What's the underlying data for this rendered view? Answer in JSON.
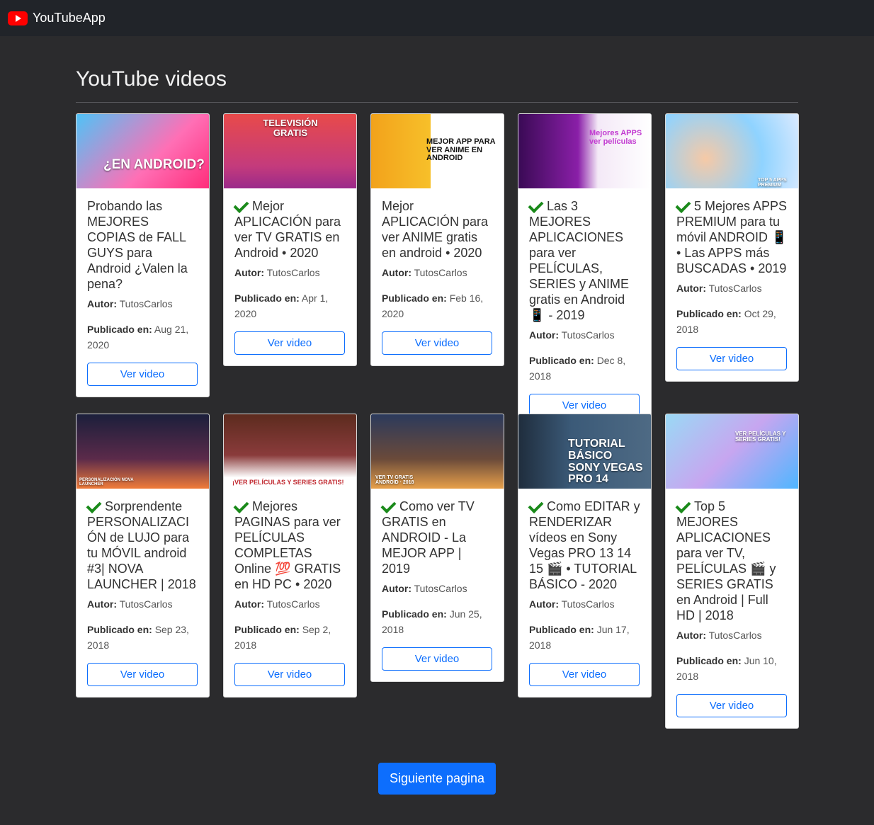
{
  "app": {
    "name": "YouTubeApp"
  },
  "page": {
    "heading": "YouTube videos"
  },
  "labels": {
    "author": "Autor:",
    "published": "Publicado en:",
    "watch": "Ver video"
  },
  "pagination": {
    "next_label": "Siguiente pagina"
  },
  "videos": [
    {
      "title": "Probando las MEJORES COPIAS de FALL GUYS para Android ¿Valen la pena?",
      "check": false,
      "author": "TutosCarlos",
      "date": "Aug 21, 2020",
      "thumb_caption": "¿EN ANDROID?"
    },
    {
      "title": "Mejor APLICACIÓN para ver TV GRATIS en Android • 2020",
      "check": true,
      "author": "TutosCarlos",
      "date": "Apr 1, 2020",
      "thumb_caption": "TELEVISIÓN GRATIS"
    },
    {
      "title": "Mejor APLICACIÓN para ver ANIME gratis en android • 2020",
      "check": false,
      "author": "TutosCarlos",
      "date": "Feb 16, 2020",
      "thumb_caption": "MEJOR APP PARA VER ANIME EN ANDROID"
    },
    {
      "title": "Las 3 MEJORES APLICACIONES para ver PELÍCULAS, SERIES y ANIME gratis en Android 📱 - 2019",
      "check": true,
      "author": "TutosCarlos",
      "date": "Dec 8, 2018",
      "thumb_caption": "Mejores APPS ver películas"
    },
    {
      "title": "5 Mejores APPS PREMIUM para tu móvil ANDROID 📱 • Las APPS más BUSCADAS • 2019",
      "check": true,
      "author": "TutosCarlos",
      "date": "Oct 29, 2018",
      "thumb_caption": "TOP 5 APPS PREMIUM"
    },
    {
      "title": "Sorprendente PERSONALIZACIÓN de LUJO para tu MÓVIL android #3| NOVA LAUNCHER | 2018",
      "check": true,
      "author": "TutosCarlos",
      "date": "Sep 23, 2018",
      "thumb_caption": "PERSONALIZACIÓN NOVA LAUNCHER"
    },
    {
      "title": "Mejores PAGINAS para ver PELÍCULAS COMPLETAS Online 💯 GRATIS en HD PC • 2020",
      "check": true,
      "author": "TutosCarlos",
      "date": "Sep 2, 2018",
      "thumb_caption": "¡VER PELÍCULAS Y SERIES GRATIS!"
    },
    {
      "title": "Como ver TV GRATIS en ANDROID - La MEJOR APP | 2019",
      "check": true,
      "author": "TutosCarlos",
      "date": "Jun 25, 2018",
      "thumb_caption": "VER TV GRATIS ANDROID · 2018"
    },
    {
      "title": "Como EDITAR y RENDERIZAR vídeos en Sony Vegas PRO 13 14 15 🎬 • TUTORIAL BÁSICO - 2020",
      "check": true,
      "author": "TutosCarlos",
      "date": "Jun 17, 2018",
      "thumb_caption": "TUTORIAL BÁSICO SONY VEGAS PRO 14"
    },
    {
      "title": "Top 5 MEJORES APLICACIONES para ver TV, PELÍCULAS 🎬 y SERIES GRATIS en Android | Full HD | 2018",
      "check": true,
      "author": "TutosCarlos",
      "date": "Jun 10, 2018",
      "thumb_caption": "VER PELÍCULAS Y SERIES GRATIS!"
    }
  ],
  "colors": {
    "page_bg": "#2b2b2d",
    "navbar_bg": "#212429",
    "primary": "#0d6efd",
    "brand_red": "#ff0000",
    "check_green": "#1a8a1a"
  }
}
